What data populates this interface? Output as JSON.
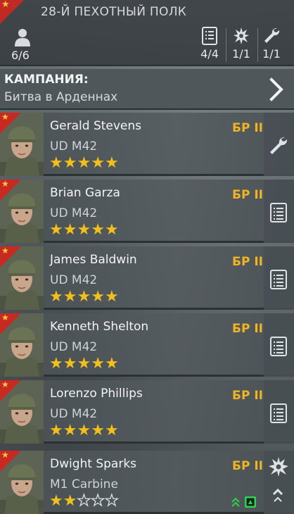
{
  "header": {
    "unit_title": "28-Й ПЕХОТНЫЙ ПОЛК",
    "squad_count": "6/6",
    "stats": [
      {
        "icon": "list-icon",
        "value": "4/4"
      },
      {
        "icon": "explosion-icon",
        "value": "1/1"
      },
      {
        "icon": "wrench-icon",
        "value": "1/1"
      }
    ]
  },
  "campaign": {
    "label": "КАМПАНИЯ:",
    "name": "Битва в Арденнах"
  },
  "soldiers": [
    {
      "name": "Gerald Stevens",
      "weapon": "UD M42",
      "rank": "БР II",
      "stars": 5,
      "max_stars": 5,
      "role_icon": "wrench-icon"
    },
    {
      "name": "Brian Garza",
      "weapon": "UD M42",
      "rank": "БР II",
      "stars": 5,
      "max_stars": 5,
      "role_icon": "list-icon"
    },
    {
      "name": "James Baldwin",
      "weapon": "UD M42",
      "rank": "БР II",
      "stars": 5,
      "max_stars": 5,
      "role_icon": "list-icon"
    },
    {
      "name": "Kenneth Shelton",
      "weapon": "UD M42",
      "rank": "БР II",
      "stars": 5,
      "max_stars": 5,
      "role_icon": "list-icon"
    },
    {
      "name": "Lorenzo Phillips",
      "weapon": "UD M42",
      "rank": "БР II",
      "stars": 5,
      "max_stars": 5,
      "role_icon": "list-icon"
    },
    {
      "name": "Dwight Sparks",
      "weapon": "M1 Carbine",
      "rank": "БР II",
      "stars": 2,
      "max_stars": 5,
      "role_icon": "explosion-icon"
    }
  ],
  "colors": {
    "accent_gold": "#f0b423",
    "star_gold": "#f2c01b",
    "badge_red": "#c82a21",
    "upgrade_green": "#2fd14a"
  }
}
